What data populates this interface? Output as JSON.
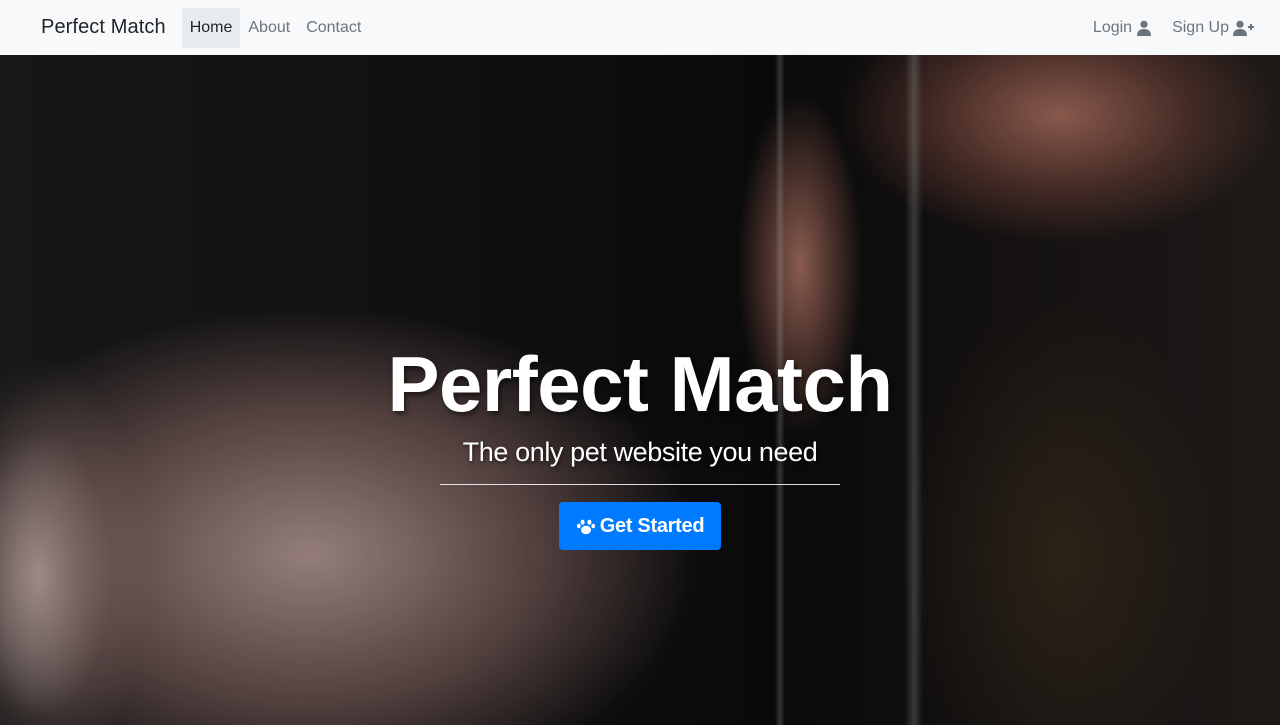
{
  "navbar": {
    "brand": "Perfect Match",
    "links": [
      {
        "label": "Home",
        "active": true
      },
      {
        "label": "About",
        "active": false
      },
      {
        "label": "Contact",
        "active": false
      }
    ],
    "login_label": "Login",
    "login_icon": "user-icon",
    "signup_label": "Sign Up",
    "signup_icon": "user-plus-icon"
  },
  "hero": {
    "title": "Perfect Match",
    "subtitle": "The only pet website you need",
    "cta_label": "Get Started",
    "cta_icon": "paw-icon",
    "background_image": "kitten-paw-touching-finger-photo"
  },
  "colors": {
    "navbar_bg": "#f8f9fa",
    "primary": "#007bff",
    "nav_text": "#6c757d",
    "brand_text": "#212529"
  }
}
